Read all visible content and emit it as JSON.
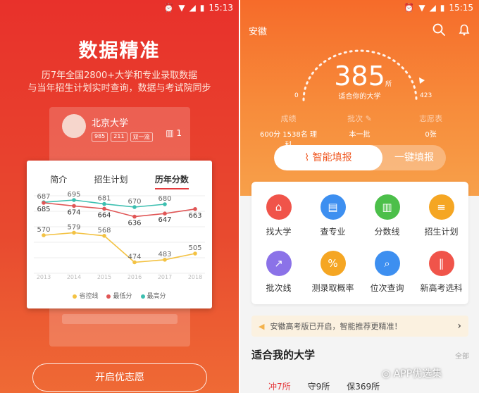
{
  "left": {
    "status_time": "15:13",
    "title": "数据精准",
    "subtitle_lines": [
      "历7年全国2800+大学和专业录取数据",
      "与当年招生计划实时查询，数据与考试院同步"
    ],
    "ghost_card": {
      "university": "北京大学",
      "tags": [
        "985",
        "211",
        "双一流"
      ],
      "count": "1"
    },
    "chart_tabs": [
      "简介",
      "招生计划",
      "历年分数"
    ],
    "legend": [
      "省控线",
      "最低分",
      "最高分"
    ],
    "cta_label": "开启优志愿"
  },
  "chart_data": {
    "type": "line",
    "categories": [
      "2013",
      "2014",
      "2015",
      "2016",
      "2017",
      "2018"
    ],
    "series": [
      {
        "name": "最高分",
        "values": [
          687,
          695,
          681,
          670,
          680,
          null
        ],
        "color": "#3cbfb0"
      },
      {
        "name": "最低分",
        "values": [
          685,
          674,
          664,
          636,
          647,
          663
        ],
        "color": "#e05656"
      },
      {
        "name": "省控线",
        "values": [
          570,
          579,
          568,
          474,
          483,
          505
        ],
        "color": "#f3c243"
      }
    ],
    "grid": true,
    "legend_position": "bottom"
  },
  "right": {
    "status_time": "15:15",
    "province": "安徽",
    "score": "385",
    "score_unit": "所",
    "score_desc": "适合你的大学",
    "scale_min": "0",
    "scale_max": "423",
    "stats": [
      {
        "label": "成绩",
        "value": "600分 1538名 理科"
      },
      {
        "label": "批次",
        "value": "本一批"
      },
      {
        "label": "志愿表",
        "value": "0张"
      }
    ],
    "mode_smart": "智能填报",
    "mode_quick": "一键填报",
    "grid_items": [
      {
        "label": "找大学",
        "icon": "bank-icon",
        "color": "#f0544a"
      },
      {
        "label": "查专业",
        "icon": "book-icon",
        "color": "#3d8ff0"
      },
      {
        "label": "分数线",
        "icon": "bar-chart-icon",
        "color": "#4cbf4a"
      },
      {
        "label": "招生计划",
        "icon": "document-icon",
        "color": "#f5a623"
      },
      {
        "label": "批次线",
        "icon": "line-chart-icon",
        "color": "#8b72e8"
      },
      {
        "label": "测录取概率",
        "icon": "percent-icon",
        "color": "#f5a623"
      },
      {
        "label": "位次查询",
        "icon": "search-doc-icon",
        "color": "#3d8ff0"
      },
      {
        "label": "新高考选科",
        "icon": "books-icon",
        "color": "#f0544a"
      }
    ],
    "notice": "安徽高考版已开启，智能推荐更精准！",
    "section_title": "适合我的大学",
    "section_all": "全部",
    "tabs": [
      "冲7所",
      "守9所",
      "保369所"
    ],
    "watermark": "APP优选集"
  }
}
